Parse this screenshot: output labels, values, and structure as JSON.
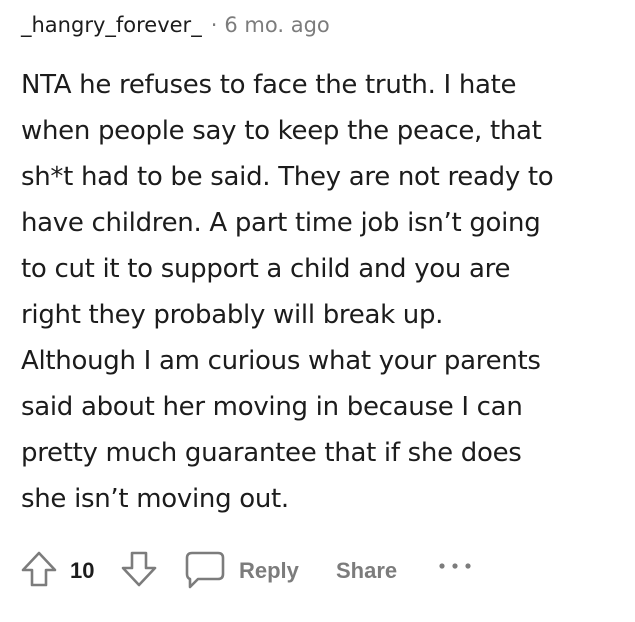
{
  "comment": {
    "username": "_hangry_forever_",
    "separator": "·",
    "age": "6 mo. ago",
    "body_lines": [
      "NTA he refuses to face the truth. I hate",
      "when people say to keep the peace, that",
      "sh*t had to be said. They are not ready to",
      "have children. A part time job isn’t going",
      "to cut it to support a child and you are",
      "right they probably will break up.",
      "Although I am curious what your parents",
      "said about her moving in because I can",
      "pretty much guarantee that if she does",
      "she isn’t moving out."
    ]
  },
  "actions": {
    "score": "10",
    "reply_label": "Reply",
    "share_label": "Share",
    "icons": {
      "upvote": "upvote-arrow-icon",
      "downvote": "downvote-arrow-icon",
      "reply": "speech-bubble-icon",
      "more": "more-options-icon"
    }
  },
  "colors": {
    "text": "#1c1c1c",
    "muted": "#7c7c7c",
    "background": "#ffffff"
  }
}
